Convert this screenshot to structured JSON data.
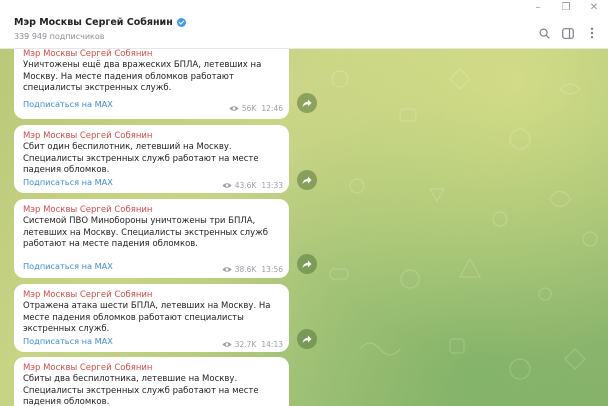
{
  "window": {
    "controls": [
      "–",
      "❐",
      "✕"
    ]
  },
  "header": {
    "title": "Мэр Москвы Сергей Собянин",
    "subscribers": "339 949 подписчиков",
    "verified_color": "#3d9be9"
  },
  "colors": {
    "sender": "#d34b4b",
    "link": "#3a8fd0"
  },
  "messages": [
    {
      "sender": "Мэр Москвы Сергей Собянин",
      "text": "Уничтожены ещё два вражеских БПЛА, летевших на Москву. На месте падения обломков работают специалисты экстренных служб.",
      "link": "Подписаться на MAX",
      "views": "56K",
      "time": "12:46"
    },
    {
      "sender": "Мэр Москвы Сергей Собянин",
      "text": "Сбит один беспилотник, летевший на Москву. Специалисты экстренных служб работают на месте падения обломков.",
      "link": "Подписаться на MAX",
      "views": "43.6K",
      "time": "13:33"
    },
    {
      "sender": "Мэр Москвы Сергей Собянин",
      "text": "Системой ПВО Минобороны уничтожены три БПЛА, летевших на Москву. Специалисты экстренных служб работают на месте падения обломков.",
      "link": "Подписаться на MAX",
      "views": "38.6K",
      "time": "13:56"
    },
    {
      "sender": "Мэр Москвы Сергей Собянин",
      "text": "Отражена атака шести БПЛА, летевших на Москву. На месте падения обломков работают специалисты экстренных служб.",
      "link": "Подписаться на MAX",
      "views": "32.7K",
      "time": "14:13"
    },
    {
      "sender": "Мэр Москвы Сергей Собянин",
      "text": "Сбиты два беспилотника, летевшие на Москву. Специалисты экстренных служб работают на месте падения обломков."
    }
  ]
}
